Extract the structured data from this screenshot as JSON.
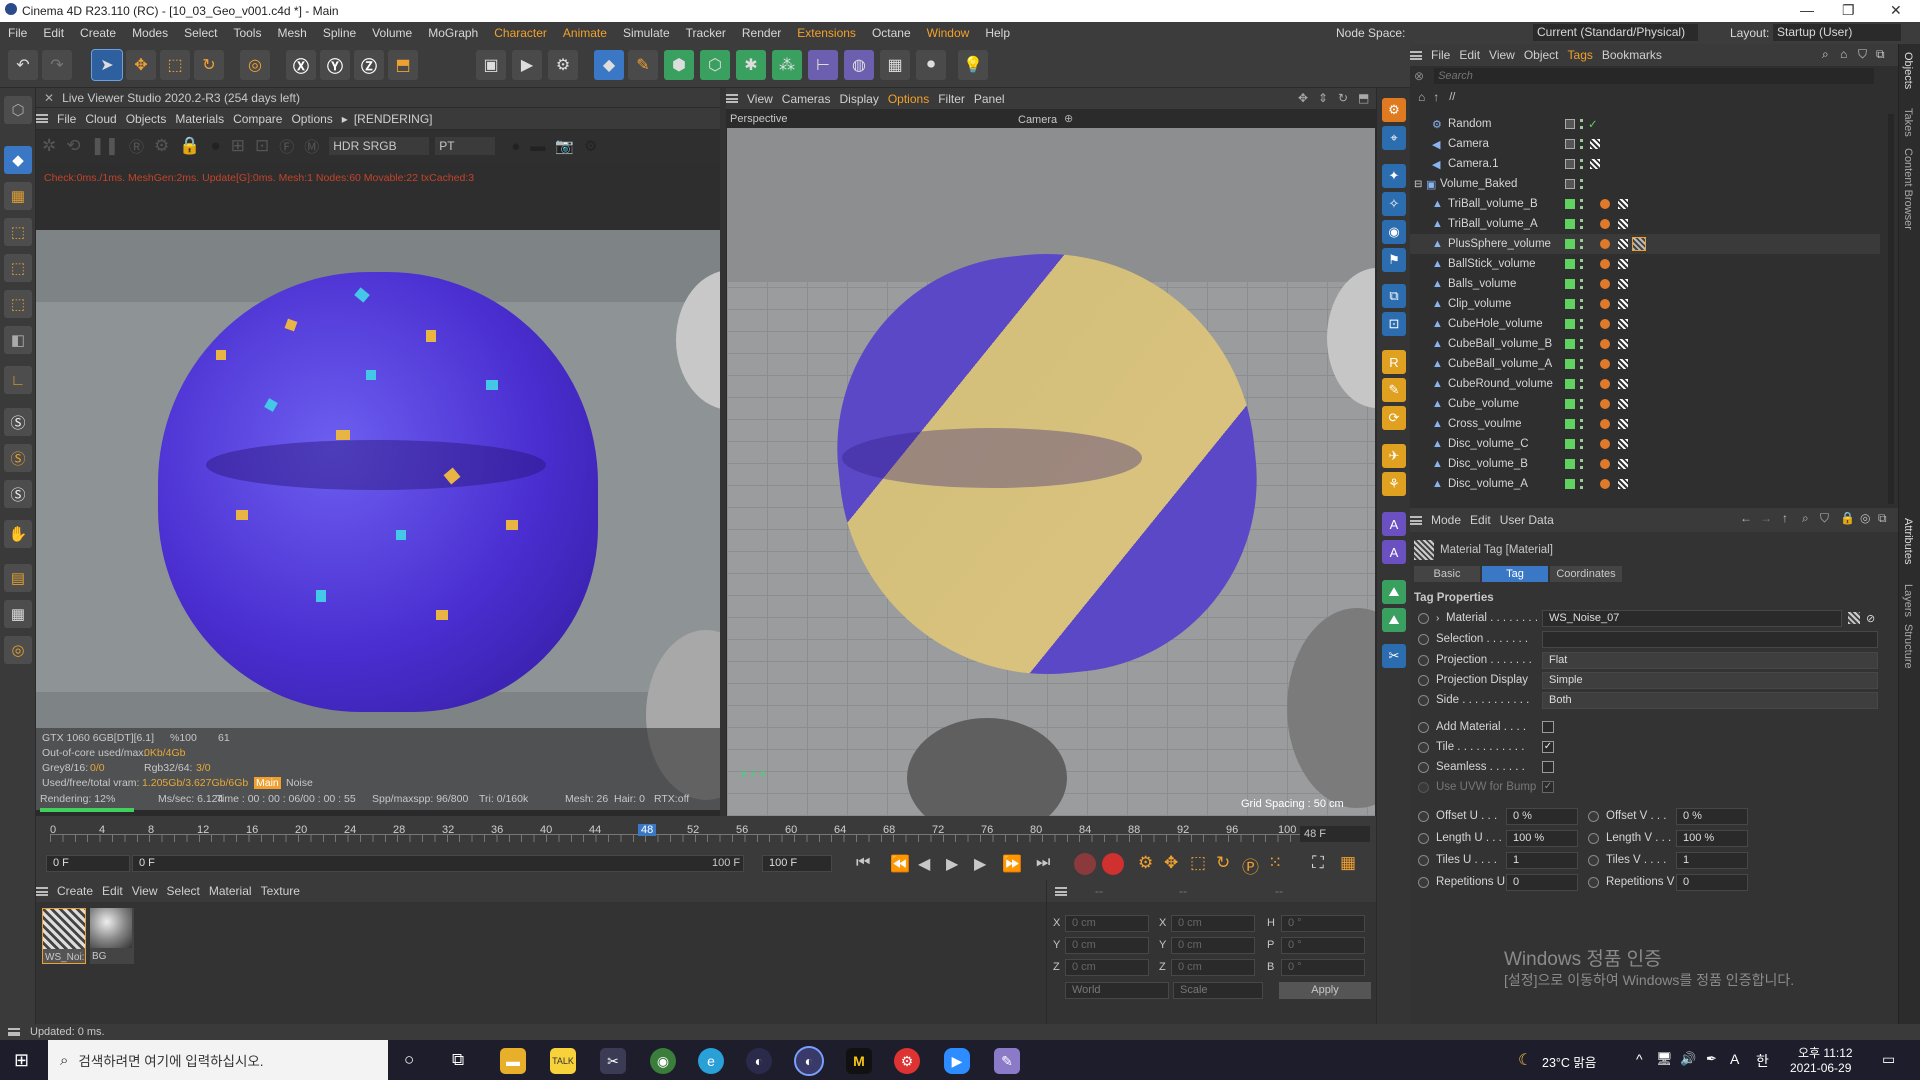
{
  "titlebar": {
    "title": "Cinema 4D R23.110 (RC) - [10_03_Geo_v001.c4d *] - Main"
  },
  "menu": {
    "items": [
      "File",
      "Edit",
      "Create",
      "Modes",
      "Select",
      "Tools",
      "Mesh",
      "Spline",
      "Volume",
      "MoGraph",
      "Character",
      "Animate",
      "Simulate",
      "Tracker",
      "Render",
      "Extensions",
      "Octane",
      "Window",
      "Help"
    ],
    "node_space_label": "Node Space:",
    "node_space_value": "Current (Standard/Physical)",
    "layout_label": "Layout:",
    "layout_value": "Startup (User)"
  },
  "liveviewer": {
    "title": "Live Viewer Studio 2020.2-R3 (254 days left)",
    "menu": [
      "File",
      "Cloud",
      "Objects",
      "Materials",
      "Compare",
      "Options"
    ],
    "status": "[RENDERING]",
    "colorspace": "HDR SRGB",
    "mode": "PT",
    "check": "Check:0ms./1ms. MeshGen:2ms. Update[G]:0ms. Mesh:1 Nodes:60 Movable:22 txCached:3",
    "gpu": "GTX 1060 6GB[DT][6.1]",
    "gpu_pct": "%100",
    "gpu_num": "61",
    "outofcore": "Out-of-core used/max:",
    "outofcore_val": "0Kb/4Gb",
    "grey_label": "Grey8/16:",
    "grey_val": "0/0",
    "rgb_label": "Rgb32/64:",
    "rgb_val": "3/0",
    "vram_label": "Used/free/total vram:",
    "vram_val": "1.205Gb/3.627Gb/6Gb",
    "tag_main": "Main",
    "tag_noise": "Noise",
    "rendering": "Rendering: 12%",
    "mssec": "Ms/sec: 6.124",
    "time": "Time : 00 : 00 : 06/00 : 00 : 55",
    "spp": "Spp/maxspp: 96/800",
    "tri": "Tri: 0/160k",
    "mesh": "Mesh: 26",
    "hair": "Hair: 0",
    "rtx": "RTX:off"
  },
  "viewport": {
    "menu": [
      "View",
      "Cameras",
      "Display",
      "Options",
      "Filter",
      "Panel"
    ],
    "label": "Perspective",
    "camera": "Camera",
    "grid": "Grid Spacing : 50 cm"
  },
  "timeline": {
    "ticks": [
      "0",
      "4",
      "8",
      "12",
      "16",
      "20",
      "24",
      "28",
      "32",
      "36",
      "40",
      "44",
      "48",
      "52",
      "56",
      "60",
      "64",
      "68",
      "72",
      "76",
      "80",
      "84",
      "88",
      "92",
      "96",
      "100"
    ],
    "current": "48 F",
    "start": "0 F",
    "start2": "0 F",
    "end": "100 F",
    "end2": "100 F"
  },
  "materials": {
    "menu": [
      "Create",
      "Edit",
      "View",
      "Select",
      "Material",
      "Texture"
    ],
    "items": [
      "WS_Noi:",
      "BG"
    ]
  },
  "coords": {
    "x": "0 cm",
    "y": "0 cm",
    "z": "0 cm",
    "sx": "0 cm",
    "sy": "0 cm",
    "sz": "0 cm",
    "h": "0 °",
    "p": "0 °",
    "b": "0 °",
    "world": "World",
    "scale": "Scale",
    "apply": "Apply",
    "dash": "--"
  },
  "objmgr": {
    "menu": [
      "File",
      "Edit",
      "View",
      "Object",
      "Tags",
      "Bookmarks"
    ],
    "search": "Search",
    "path": "//",
    "objects": [
      "Random",
      "Camera",
      "Camera.1",
      "Volume_Baked",
      "TriBall_volume_B",
      "TriBall_volume_A",
      "PlusSphere_volume",
      "BallStick_volume",
      "Balls_volume",
      "Clip_volume",
      "CubeHole_volume",
      "CubeBall_volume_B",
      "CubeBall_volume_A",
      "CubeRound_volume",
      "Cube_volume",
      "Cross_voulme",
      "Disc_volume_C",
      "Disc_volume_B",
      "Disc_volume_A"
    ]
  },
  "attr": {
    "menu": [
      "Mode",
      "Edit",
      "User Data"
    ],
    "title": "Material Tag [Material]",
    "tabs": [
      "Basic",
      "Tag",
      "Coordinates"
    ],
    "section": "Tag Properties",
    "material_label": "Material . . . . . . . .",
    "material_value": "WS_Noise_07",
    "selection_label": "Selection . . . . . . .",
    "projection_label": "Projection . . . . . . .",
    "projection_value": "Flat",
    "projdisp_label": "Projection Display",
    "projdisp_value": "Simple",
    "side_label": "Side . . . . . . . . . . .",
    "side_value": "Both",
    "addmat_label": "Add Material . . . .",
    "tile_label": "Tile . . . . . . . . . . .",
    "seamless_label": "Seamless . . . . . .",
    "uvw_label": "Use UVW for Bump",
    "offu_label": "Offset U . . .",
    "offu": "0 %",
    "offv_label": "Offset V . . .",
    "offv": "0 %",
    "lenu_label": "Length U . . .",
    "lenu": "100 %",
    "lenv_label": "Length V . . .",
    "lenv": "100 %",
    "tilu_label": "Tiles U . . . .",
    "tilu": "1",
    "tilv_label": "Tiles V . . . .",
    "tilv": "1",
    "repu_label": "Repetitions U",
    "repu": "0",
    "repv_label": "Repetitions V",
    "repv": "0"
  },
  "watermark": {
    "line1": "Windows 정품 인증",
    "line2": "[설정]으로 이동하여 Windows를 정품 인증합니다."
  },
  "sidetabs": [
    "Objects",
    "Takes",
    "Content Browser",
    "Attributes",
    "Layers",
    "Structure"
  ],
  "status": "Updated: 0 ms.",
  "taskbar": {
    "search": "검색하려면 여기에 입력하십시오.",
    "weather": "23°C 맑음",
    "ime1": "A",
    "ime2": "한",
    "time": "오후 11:12",
    "date": "2021-06-29"
  }
}
